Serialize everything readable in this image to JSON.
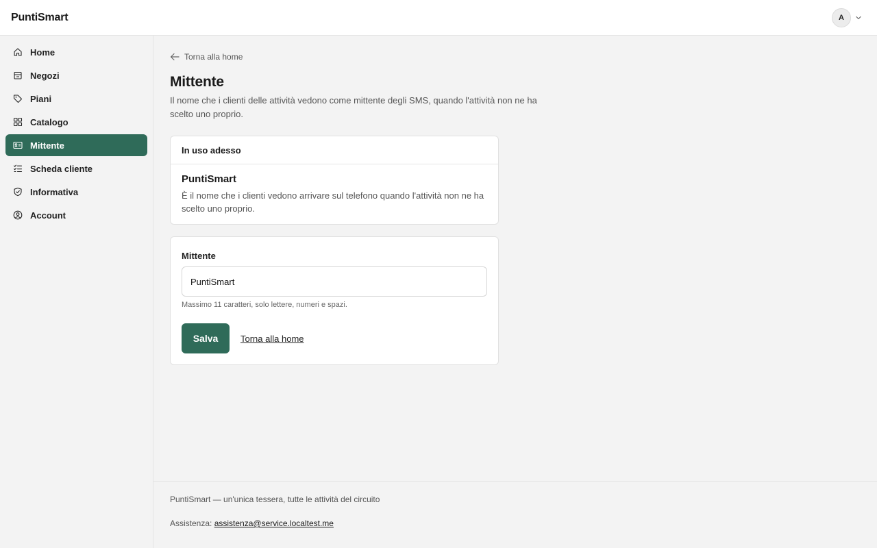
{
  "app": {
    "brand": "PuntiSmart"
  },
  "user": {
    "avatar_initial": "A"
  },
  "sidebar": {
    "items": [
      {
        "label": "Home",
        "icon": "home-icon"
      },
      {
        "label": "Negozi",
        "icon": "store-icon"
      },
      {
        "label": "Piani",
        "icon": "tag-icon"
      },
      {
        "label": "Catalogo",
        "icon": "grid-icon"
      },
      {
        "label": "Mittente",
        "icon": "id-card-icon",
        "active": true
      },
      {
        "label": "Scheda cliente",
        "icon": "checklist-icon"
      },
      {
        "label": "Informativa",
        "icon": "shield-check-icon"
      },
      {
        "label": "Account",
        "icon": "user-circle-icon"
      }
    ]
  },
  "page": {
    "back_label": "Torna alla home",
    "title": "Mittente",
    "description": "Il nome che i clienti delle attività vedono come mittente degli SMS, quando l'attività non ne ha scelto uno proprio."
  },
  "current_card": {
    "header": "In uso adesso",
    "sender_name": "PuntiSmart",
    "note": "È il nome che i clienti vedono arrivare sul telefono quando l'attività non ne ha scelto uno proprio."
  },
  "form": {
    "label": "Mittente",
    "value": "PuntiSmart",
    "hint": "Massimo 11 caratteri, solo lettere, numeri e spazi.",
    "save_label": "Salva",
    "back_link": "Torna alla home"
  },
  "footer": {
    "tagline": "PuntiSmart — un'unica tessera, tutte le attività del circuito",
    "support_label": "Assistenza:",
    "support_email": "assistenza@service.localtest.me"
  },
  "colors": {
    "accent": "#2f6b59",
    "background": "#f3f3f3",
    "card": "#ffffff"
  }
}
